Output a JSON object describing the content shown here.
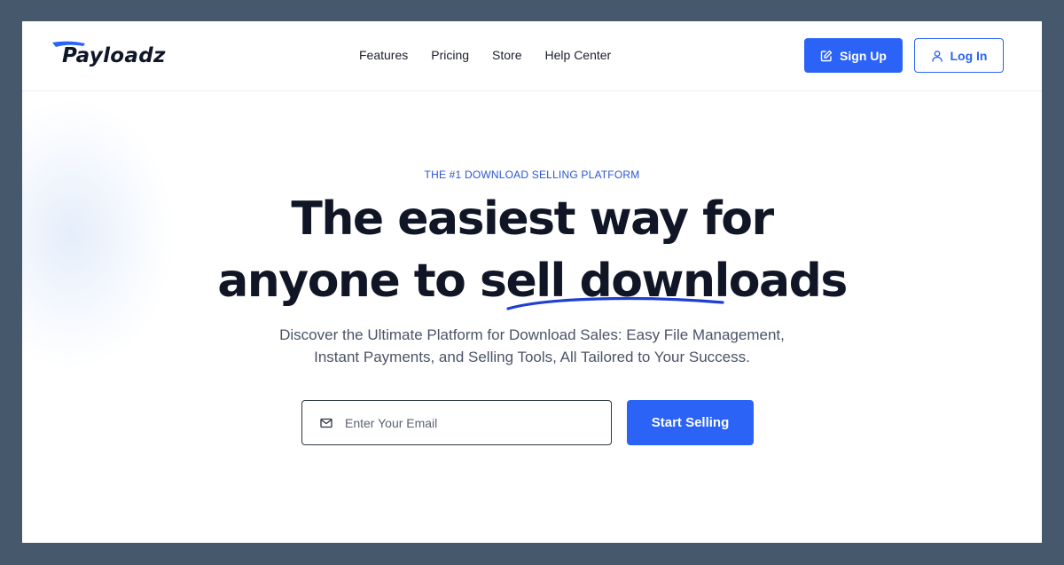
{
  "brand": {
    "name": "Payloadz",
    "accent_color": "#2a63f6",
    "logo_icon": "swoosh-icon"
  },
  "nav": {
    "items": [
      {
        "label": "Features"
      },
      {
        "label": "Pricing"
      },
      {
        "label": "Store"
      },
      {
        "label": "Help Center"
      }
    ]
  },
  "header": {
    "signup_label": "Sign Up",
    "signup_icon": "edit-icon",
    "login_label": "Log In",
    "login_icon": "user-icon"
  },
  "hero": {
    "eyebrow": "THE #1 DOWNLOAD SELLING PLATFORM",
    "headline_line1": "The easiest way for",
    "headline_line2": "anyone to sell downloads",
    "subtext_line1": "Discover the Ultimate Platform for Download Sales: Easy File Management,",
    "subtext_line2": "Instant Payments, and Selling Tools, All Tailored to Your Success."
  },
  "signup_form": {
    "email_placeholder": "Enter Your Email",
    "email_value": "",
    "email_icon": "mail-icon",
    "submit_label": "Start Selling"
  }
}
